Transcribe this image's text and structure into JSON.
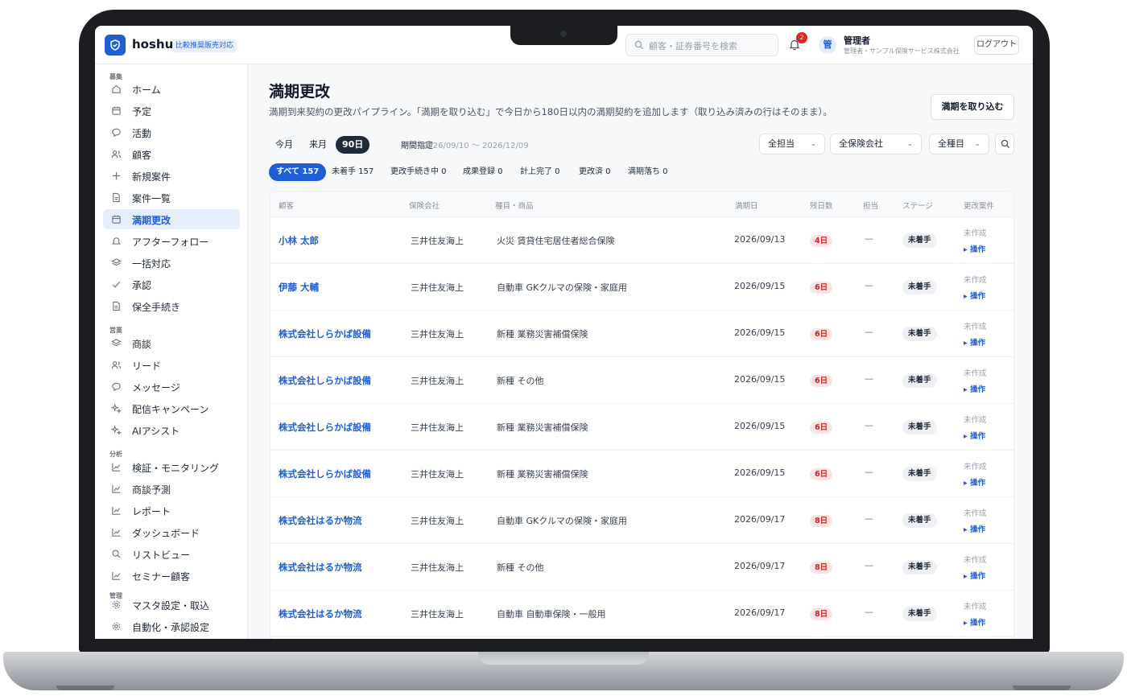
{
  "app": {
    "brand": "hoshu",
    "plan_badge": "比較推奨販売対応"
  },
  "header": {
    "search_placeholder": "顧客・証券番号を検索",
    "notification_count": "2",
    "avatar_initial": "管",
    "user_name": "管理者",
    "user_role": "管理者・サンプル保険サービス株式会社",
    "logout_label": "ログアウト"
  },
  "sidebar": {
    "sections": [
      "募集",
      "営業",
      "分析",
      "管理"
    ],
    "items": [
      {
        "label": "ホーム",
        "icon": "home-icon"
      },
      {
        "label": "予定",
        "icon": "calendar-icon"
      },
      {
        "label": "活動",
        "icon": "chat-icon"
      },
      {
        "label": "顧客",
        "icon": "users-icon"
      },
      {
        "label": "新規案件",
        "icon": "plus-icon"
      },
      {
        "label": "案件一覧",
        "icon": "document-icon"
      },
      {
        "label": "満期更改",
        "icon": "calendar-icon",
        "active": true
      },
      {
        "label": "アフターフォロー",
        "icon": "bell-icon"
      },
      {
        "label": "一括対応",
        "icon": "layers-icon"
      },
      {
        "label": "承認",
        "icon": "check-icon"
      },
      {
        "label": "保全手続き",
        "icon": "document-icon"
      },
      {
        "label": "商談",
        "icon": "layers-icon"
      },
      {
        "label": "リード",
        "icon": "users-icon"
      },
      {
        "label": "メッセージ",
        "icon": "chat-icon"
      },
      {
        "label": "配信キャンペーン",
        "icon": "sparkle-icon"
      },
      {
        "label": "AIアシスト",
        "icon": "sparkle-icon"
      },
      {
        "label": "検証・モニタリング",
        "icon": "chart-icon"
      },
      {
        "label": "商談予測",
        "icon": "chart-icon"
      },
      {
        "label": "レポート",
        "icon": "chart-icon"
      },
      {
        "label": "ダッシュボード",
        "icon": "chart-icon"
      },
      {
        "label": "リストビュー",
        "icon": "search-icon"
      },
      {
        "label": "セミナー顧客",
        "icon": "chart-icon"
      },
      {
        "label": "マスタ設定・取込",
        "icon": "gear-icon"
      },
      {
        "label": "自動化・承認設定",
        "icon": "gear-icon"
      }
    ]
  },
  "main": {
    "title": "満期更改",
    "description": "満期到来契約の更改パイプライン。「満期を取り込む」で今日から180日以内の満期契約を追加します（取り込み済みの行はそのまま）。",
    "import_button": "満期を取り込む",
    "periods": [
      "今月",
      "来月",
      "90日"
    ],
    "active_period": "90日",
    "period_custom_label": "期間指定",
    "period_range": "2026/09/10 〜 2026/12/09",
    "filters": [
      "全担当",
      "全保険会社",
      "全種目"
    ],
    "chips": [
      "すべて 157",
      "未着手 157",
      "更改手続き中 0",
      "成果登録 0",
      "計上完了 0",
      "更改済 0",
      "満期落ち 0"
    ],
    "columns": [
      "顧客",
      "保険会社",
      "種目・商品",
      "満期日",
      "残日数",
      "担当",
      "ステージ",
      "更改案件"
    ],
    "rows": [
      {
        "customer": "小林 太郎",
        "insurer": "三井住友海上",
        "product": "火災 賃貸住宅居住者総合保険",
        "date": "2026/09/13",
        "days": "4日",
        "owner": "—",
        "stage": "未着手",
        "renewal_status": "未作成",
        "action": "操作"
      },
      {
        "customer": "伊藤 大輔",
        "insurer": "三井住友海上",
        "product": "自動車 GKクルマの保険・家庭用",
        "date": "2026/09/15",
        "days": "6日",
        "owner": "—",
        "stage": "未着手",
        "renewal_status": "未作成",
        "action": "操作"
      },
      {
        "customer": "株式会社しらかば設備",
        "insurer": "三井住友海上",
        "product": "新種 業務災害補償保険",
        "date": "2026/09/15",
        "days": "6日",
        "owner": "—",
        "stage": "未着手",
        "renewal_status": "未作成",
        "action": "操作"
      },
      {
        "customer": "株式会社しらかば設備",
        "insurer": "三井住友海上",
        "product": "新種 その他",
        "date": "2026/09/15",
        "days": "6日",
        "owner": "—",
        "stage": "未着手",
        "renewal_status": "未作成",
        "action": "操作"
      },
      {
        "customer": "株式会社しらかば設備",
        "insurer": "三井住友海上",
        "product": "新種 業務災害補償保険",
        "date": "2026/09/15",
        "days": "6日",
        "owner": "—",
        "stage": "未着手",
        "renewal_status": "未作成",
        "action": "操作"
      },
      {
        "customer": "株式会社しらかば設備",
        "insurer": "三井住友海上",
        "product": "新種 業務災害補償保険",
        "date": "2026/09/15",
        "days": "6日",
        "owner": "—",
        "stage": "未着手",
        "renewal_status": "未作成",
        "action": "操作"
      },
      {
        "customer": "株式会社はるか物流",
        "insurer": "三井住友海上",
        "product": "自動車 GKクルマの保険・家庭用",
        "date": "2026/09/17",
        "days": "8日",
        "owner": "—",
        "stage": "未着手",
        "renewal_status": "未作成",
        "action": "操作"
      },
      {
        "customer": "株式会社はるか物流",
        "insurer": "三井住友海上",
        "product": "新種 その他",
        "date": "2026/09/17",
        "days": "8日",
        "owner": "—",
        "stage": "未着手",
        "renewal_status": "未作成",
        "action": "操作"
      },
      {
        "customer": "株式会社はるか物流",
        "insurer": "三井住友海上",
        "product": "自動車 自動車保険・一般用",
        "date": "2026/09/17",
        "days": "8日",
        "owner": "—",
        "stage": "未着手",
        "renewal_status": "未作成",
        "action": "操作"
      }
    ]
  },
  "colors": {
    "accent": "#1f5fd6",
    "danger": "#d11f1f",
    "frame": "#1c1d20"
  }
}
